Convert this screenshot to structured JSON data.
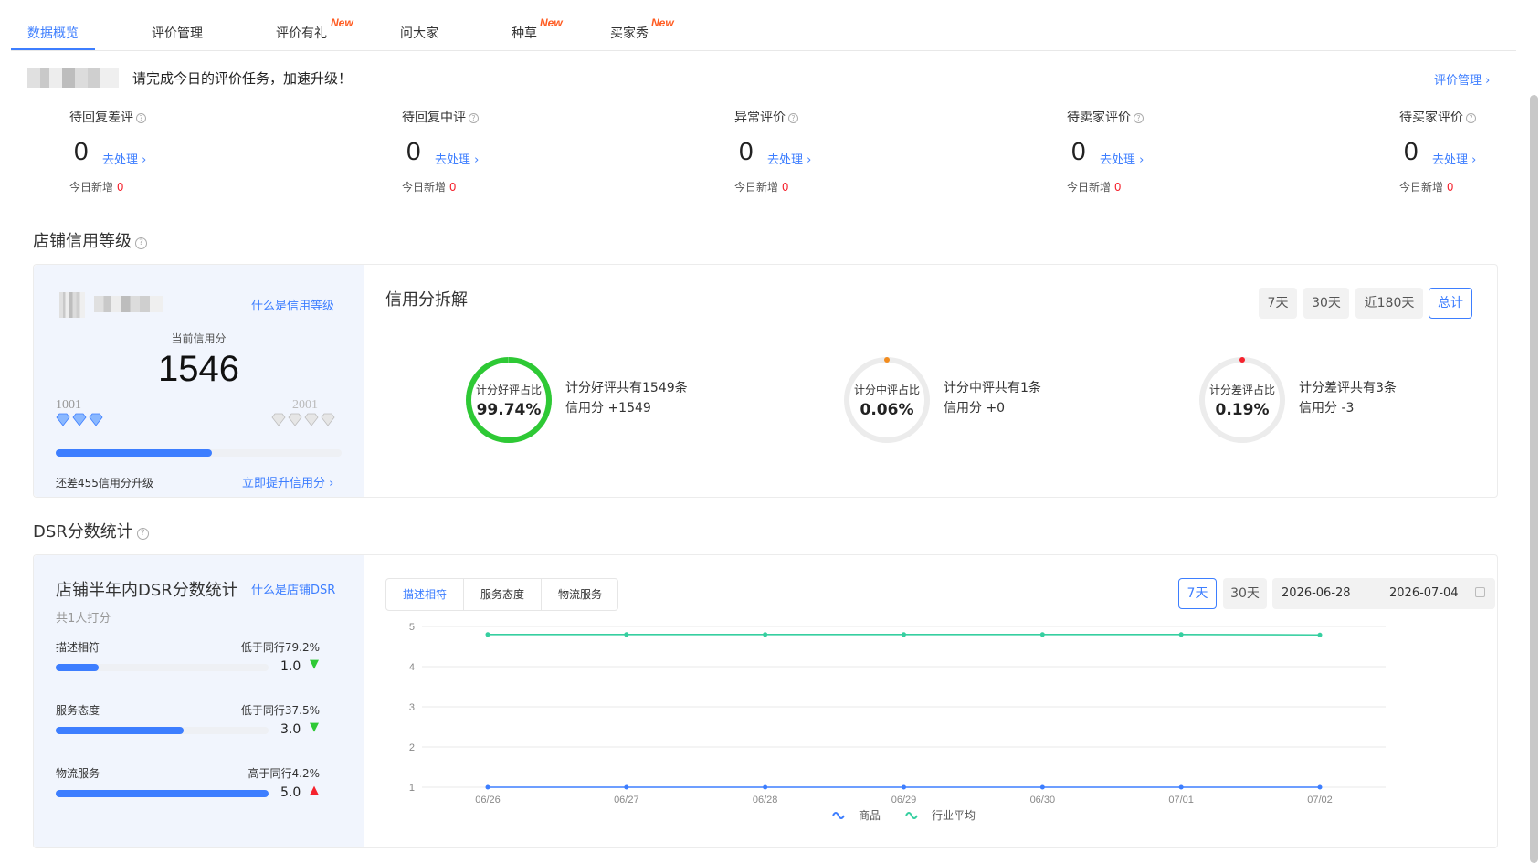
{
  "tabs": [
    {
      "label": "数据概览",
      "badge": "",
      "active": true
    },
    {
      "label": "评价管理",
      "badge": ""
    },
    {
      "label": "评价有礼",
      "badge": "New"
    },
    {
      "label": "问大家",
      "badge": ""
    },
    {
      "label": "种草",
      "badge": "New"
    },
    {
      "label": "买家秀",
      "badge": "New"
    }
  ],
  "banner": {
    "message": "请完成今日的评价任务，加速升级！",
    "manage_link": "评价管理 ›"
  },
  "metrics": [
    {
      "label": "待回复差评",
      "value": "0",
      "action": "去处理 ›",
      "today_label": "今日新增",
      "today_value": "0"
    },
    {
      "label": "待回复中评",
      "value": "0",
      "action": "去处理 ›",
      "today_label": "今日新增",
      "today_value": "0"
    },
    {
      "label": "异常评价",
      "value": "0",
      "action": "去处理 ›",
      "today_label": "今日新增",
      "today_value": "0"
    },
    {
      "label": "待卖家评价",
      "value": "0",
      "action": "去处理 ›",
      "today_label": "今日新增",
      "today_value": "0"
    },
    {
      "label": "待买家评价",
      "value": "0",
      "action": "去处理 ›",
      "today_label": "今日新增",
      "today_value": "0"
    }
  ],
  "credit": {
    "section_title": "店铺信用等级",
    "what_link": "什么是信用等级",
    "current_label": "当前信用分",
    "score": "1546",
    "min": "1001",
    "max": "2001",
    "progress_fraction": 0.545,
    "remaining_text": "还差455信用分升级",
    "upgrade_link": "立即提升信用分 ›",
    "breakdown_title": "信用分拆解",
    "periods": [
      "7天",
      "30天",
      "近180天",
      "总计"
    ],
    "active_period": "总计",
    "donuts": [
      {
        "label": "计分好评占比",
        "pct": "99.74%",
        "fraction": 0.9974,
        "color": "#2ec935",
        "dot": "",
        "line1": "计分好评共有1549条",
        "line2": "信用分 +1549"
      },
      {
        "label": "计分中评占比",
        "pct": "0.06%",
        "fraction": 0.0006,
        "color": "#f28c1e",
        "dot": "#f28c1e",
        "line1": "计分中评共有1条",
        "line2": "信用分 +0"
      },
      {
        "label": "计分差评占比",
        "pct": "0.19%",
        "fraction": 0.0019,
        "color": "#f5222d",
        "dot": "#f5222d",
        "line1": "计分差评共有3条",
        "line2": "信用分 -3"
      }
    ]
  },
  "dsr": {
    "section_title": "DSR分数统计",
    "panel_title": "店铺半年内DSR分数统计",
    "what_link": "什么是店铺DSR",
    "raters": "共1人打分",
    "items": [
      {
        "name": "描述相符",
        "compare": "低于同行79.2%",
        "score": "1.0",
        "fraction": 0.2,
        "trend": "down"
      },
      {
        "name": "服务态度",
        "compare": "低于同行37.5%",
        "score": "3.0",
        "fraction": 0.6,
        "trend": "down"
      },
      {
        "name": "物流服务",
        "compare": "高于同行4.2%",
        "score": "5.0",
        "fraction": 1.0,
        "trend": "up"
      }
    ],
    "chart_tabs": [
      "描述相符",
      "服务态度",
      "物流服务"
    ],
    "active_chart_tab": "描述相符",
    "range_buttons": [
      "7天",
      "30天"
    ],
    "active_range": "7天",
    "date_start": "2026-06-28",
    "date_end": "2026-07-04"
  },
  "chart_data": {
    "type": "line",
    "x": [
      "06/26",
      "06/27",
      "06/28",
      "06/29",
      "06/30",
      "07/01",
      "07/02"
    ],
    "ylim": [
      1,
      5
    ],
    "yticks": [
      1,
      2,
      3,
      4,
      5
    ],
    "grid": true,
    "legend": "bottom",
    "series": [
      {
        "name": "商品",
        "values": [
          1,
          1,
          1,
          1,
          1,
          1,
          1
        ],
        "color": "#3d7eff"
      },
      {
        "name": "行业平均",
        "values": [
          4.8,
          4.8,
          4.8,
          4.8,
          4.8,
          4.8,
          4.79
        ],
        "color": "#36cfa0"
      }
    ]
  }
}
